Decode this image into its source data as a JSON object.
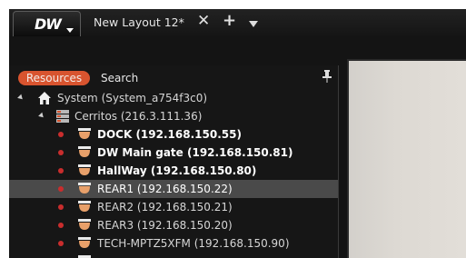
{
  "app": {
    "logo_text": "DW",
    "colors": {
      "accent": "#d8542f",
      "status_offline": "#c92d2d",
      "camera": "#e8a06a"
    }
  },
  "tabbar": {
    "layout_tab_label": "New Layout 12*",
    "close_glyph": "✕",
    "add_glyph": "+"
  },
  "panel": {
    "tabs": [
      {
        "label": "Resources",
        "active": true
      },
      {
        "label": "Search",
        "active": false
      }
    ],
    "pin_icon": "pin-icon"
  },
  "tree": {
    "system": {
      "label": "System (System_a754f3c0)",
      "icon": "house-icon"
    },
    "server": {
      "label": "Cerritos (216.3.111.36)",
      "icon": "server-icon"
    },
    "cameras": [
      {
        "label": "DOCK (192.168.150.55)",
        "bold": true,
        "selected": false
      },
      {
        "label": "DW Main gate (192.168.150.81)",
        "bold": true,
        "selected": false
      },
      {
        "label": "HallWay (192.168.150.80)",
        "bold": true,
        "selected": false
      },
      {
        "label": "REAR1 (192.168.150.22)",
        "bold": false,
        "selected": true
      },
      {
        "label": "REAR2 (192.168.150.21)",
        "bold": false,
        "selected": false
      },
      {
        "label": "REAR3 (192.168.150.20)",
        "bold": false,
        "selected": false
      },
      {
        "label": "TECH-MPTZ5XFM (192.168.150.90)",
        "bold": false,
        "selected": false
      }
    ]
  }
}
